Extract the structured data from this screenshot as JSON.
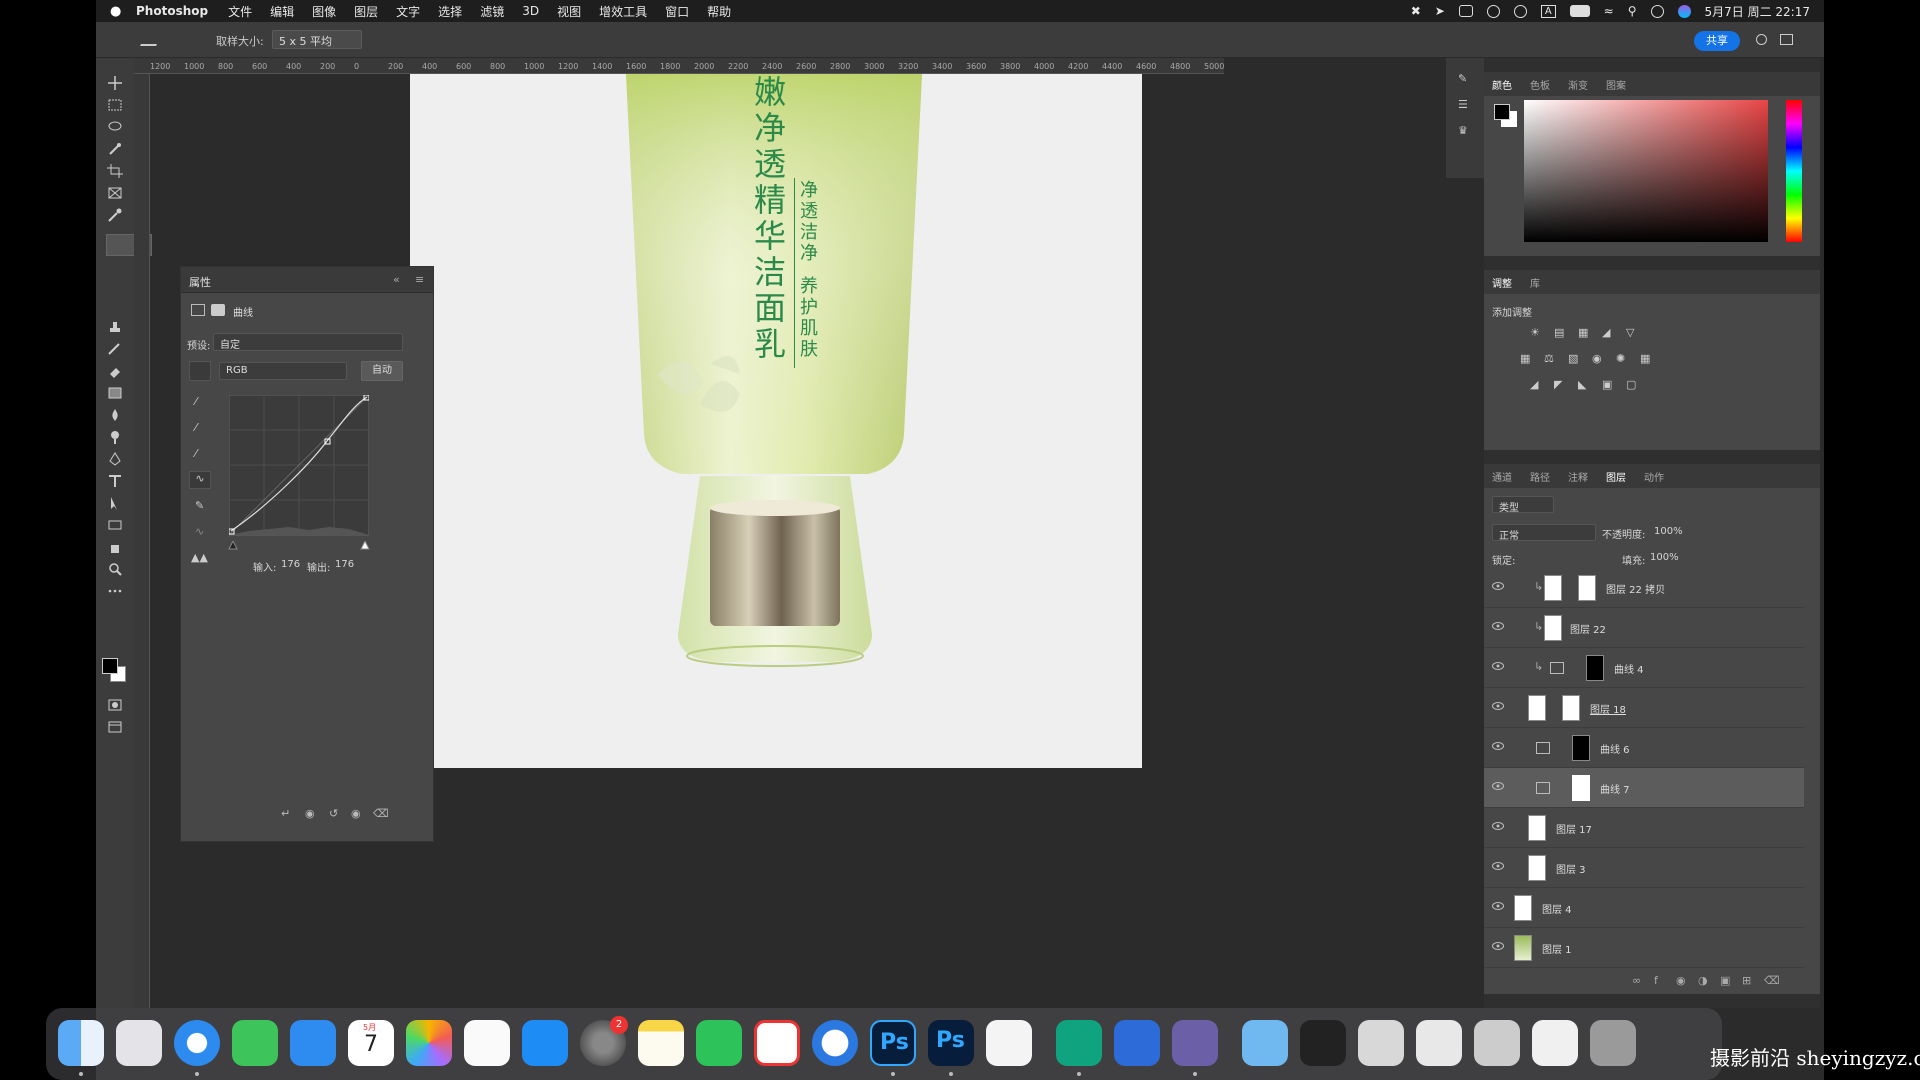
{
  "menubar": {
    "app_name": "Photoshop",
    "items": [
      "文件",
      "编辑",
      "图像",
      "图层",
      "文字",
      "选择",
      "滤镜",
      "3D",
      "视图",
      "增效工具",
      "窗口",
      "帮助"
    ],
    "input_method": "A",
    "datetime": "5月7日 周二 22:17"
  },
  "options": {
    "sample_size_label": "取样大小:",
    "sample_size_value": "5 x 5 平均",
    "share_label": "共享"
  },
  "ruler": {
    "ticks": [
      "1200",
      "1000",
      "800",
      "600",
      "400",
      "200",
      "0",
      "200",
      "400",
      "600",
      "800",
      "1000",
      "1200",
      "1400",
      "1600",
      "1800",
      "2000",
      "2200",
      "2400",
      "2600",
      "2800",
      "3000",
      "3200",
      "3400",
      "3600",
      "3800",
      "4000",
      "4200",
      "4400",
      "4600",
      "4800",
      "5000"
    ]
  },
  "product": {
    "title_vertical": "嫩净透精华洁面乳",
    "tagline_1": "净透洁净",
    "tagline_2": "养护肌肤"
  },
  "properties": {
    "tab_title": "属性",
    "type_label": "曲线",
    "preset_label": "预设:",
    "preset_value": "自定",
    "channel_value": "RGB",
    "auto_button": "自动",
    "input_label": "输入:",
    "input_value": "176",
    "output_label": "输出:",
    "output_value": "176"
  },
  "color_panel": {
    "tabs": [
      "颜色",
      "色板",
      "渐变",
      "图案"
    ],
    "hue_color": "#e84545"
  },
  "adjustments": {
    "tabs": [
      "调整",
      "库"
    ],
    "add_label": "添加调整"
  },
  "layers_panel": {
    "tabs": [
      "通道",
      "路径",
      "注释",
      "图层",
      "动作"
    ],
    "active_tab": "图层",
    "filter_label": "类型",
    "blend_mode": "正常",
    "opacity_label": "不透明度:",
    "opacity_value": "100%",
    "lock_label": "锁定:",
    "fill_label": "填充:",
    "fill_value": "100%",
    "layers": [
      {
        "name": "图层 22 拷贝",
        "kind": "pixel-mask",
        "clipped": true
      },
      {
        "name": "图层 22",
        "kind": "pixel",
        "clipped": true
      },
      {
        "name": "曲线 4",
        "kind": "curves-mask-black",
        "clipped": true
      },
      {
        "name": "图层 18",
        "kind": "pixel-mask",
        "clipped": false
      },
      {
        "name": "曲线 6",
        "kind": "curves-mask-black",
        "clipped": false
      },
      {
        "name": "曲线 7",
        "kind": "curves-mask-white",
        "clipped": false,
        "selected": true
      },
      {
        "name": "图层 17",
        "kind": "pixel",
        "clipped": false
      },
      {
        "name": "图层 3",
        "kind": "pixel",
        "clipped": false
      },
      {
        "name": "图层 4",
        "kind": "pixel-white",
        "clipped": false
      },
      {
        "name": "图层 1",
        "kind": "pixel-product",
        "clipped": false
      }
    ]
  },
  "dock": {
    "calendar_month": "5月",
    "calendar_day": "7",
    "settings_badge": "2",
    "ps_label_1": "Ps",
    "ps_label_2": "Ps"
  },
  "watermark": "摄影前沿 sheyingzyz.com"
}
